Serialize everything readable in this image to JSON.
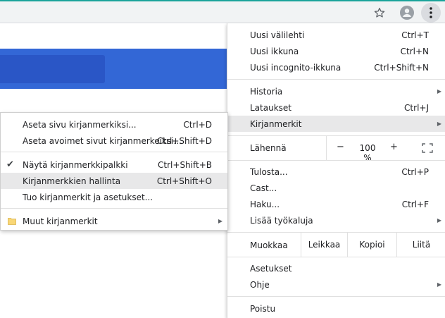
{
  "colors": {
    "toolbar_bg": "#f1f3f4",
    "accent": "#1aa39a",
    "page_blue": "#3367d6",
    "highlight": "#e8e8e9"
  },
  "toolbar": {
    "icons": [
      "star-icon",
      "avatar-icon",
      "kebab-menu-icon"
    ]
  },
  "menu": {
    "new_tab": {
      "label": "Uusi välilehti",
      "shortcut": "Ctrl+T"
    },
    "new_window": {
      "label": "Uusi ikkuna",
      "shortcut": "Ctrl+N"
    },
    "incognito": {
      "label": "Uusi incognito-ikkuna",
      "shortcut": "Ctrl+Shift+N"
    },
    "history": {
      "label": "Historia"
    },
    "downloads": {
      "label": "Lataukset",
      "shortcut": "Ctrl+J"
    },
    "bookmarks": {
      "label": "Kirjanmerkit"
    },
    "zoom": {
      "label": "Lähennä",
      "minus": "−",
      "value": "100 %",
      "plus": "+"
    },
    "print": {
      "label": "Tulosta...",
      "shortcut": "Ctrl+P"
    },
    "cast": {
      "label": "Cast..."
    },
    "find": {
      "label": "Haku...",
      "shortcut": "Ctrl+F"
    },
    "more_tools": {
      "label": "Lisää työkaluja"
    },
    "edit": {
      "label": "Muokkaa",
      "cut": "Leikkaa",
      "copy": "Kopioi",
      "paste": "Liitä"
    },
    "settings": {
      "label": "Asetukset"
    },
    "help": {
      "label": "Ohje"
    },
    "exit": {
      "label": "Poistu"
    }
  },
  "bookmarks_submenu": {
    "bookmark_page": {
      "label": "Aseta sivu kirjanmerkiksi...",
      "shortcut": "Ctrl+D"
    },
    "bookmark_all": {
      "label": "Aseta avoimet sivut kirjanmerkeiksi...",
      "shortcut": "Ctrl+Shift+D"
    },
    "show_bar": {
      "label": "Näytä kirjanmerkkipalkki",
      "shortcut": "Ctrl+Shift+B",
      "checked": true
    },
    "manager": {
      "label": "Kirjanmerkkien hallinta",
      "shortcut": "Ctrl+Shift+O"
    },
    "import": {
      "label": "Tuo kirjanmerkit ja asetukset..."
    },
    "other": {
      "label": "Muut kirjanmerkit"
    }
  }
}
